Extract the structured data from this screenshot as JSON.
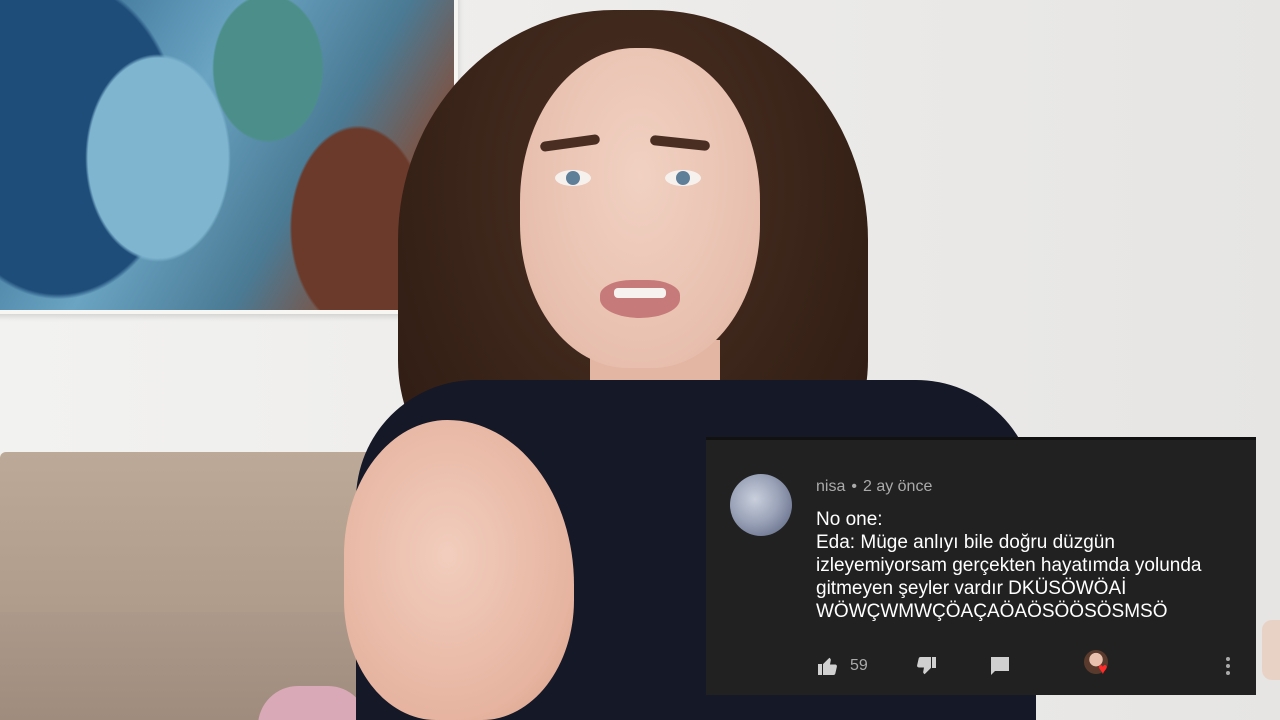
{
  "comment": {
    "author": "nisa",
    "separator": "•",
    "time": "2 ay önce",
    "text": "No one:\nEda: Müge anlıyı bile doğru düzgün izleyemiyorsam gerçekten hayatımda yolunda gitmeyen şeyler vardır DKÜSÖWÖAİ WÖWÇWMWÇÖAÇAÖAÖSÖÖSÖSMSÖ",
    "like_count": "59",
    "icons": {
      "like": "thumbs-up-icon",
      "dislike": "thumbs-down-icon",
      "reply": "reply-icon",
      "hearted": "creator-heart-icon",
      "more": "more-vert-icon"
    }
  },
  "colors": {
    "card_background": "#212121",
    "text_primary": "#ffffff",
    "text_secondary": "#aaaaaa",
    "heart": "#ff2a2a"
  }
}
